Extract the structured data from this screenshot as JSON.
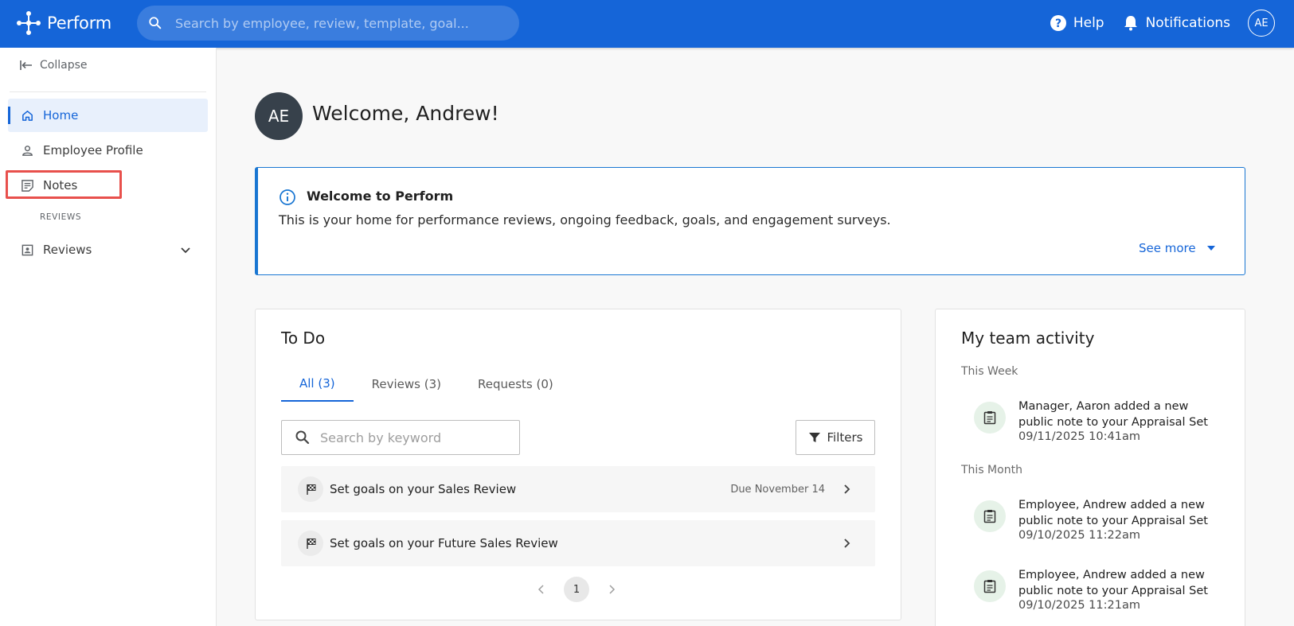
{
  "app": {
    "name": "Perform"
  },
  "header": {
    "search_placeholder": "Search by employee, review, template, goal...",
    "help_label": "Help",
    "notifications_label": "Notifications",
    "user_initials": "AE"
  },
  "sidebar": {
    "collapse_label": "Collapse",
    "items": [
      {
        "label": "Home",
        "icon": "home-icon",
        "active": true
      },
      {
        "label": "Employee Profile",
        "icon": "person-icon"
      },
      {
        "label": "Notes",
        "icon": "notes-icon",
        "highlighted": true
      }
    ],
    "section_label": "REVIEWS",
    "reviews_label": "Reviews"
  },
  "welcome": {
    "initials": "AE",
    "title": "Welcome, Andrew!"
  },
  "banner": {
    "title": "Welcome to Perform",
    "text": "This is your home for performance reviews, ongoing feedback, goals, and engagement surveys.",
    "see_more": "See more"
  },
  "todo": {
    "title": "To Do",
    "tabs": [
      {
        "label": "All (3)",
        "active": true
      },
      {
        "label": "Reviews (3)"
      },
      {
        "label": "Requests (0)"
      }
    ],
    "search_placeholder": "Search by keyword",
    "filters_label": "Filters",
    "rows": [
      {
        "text": "Set goals on your Sales Review",
        "due": "Due November 14"
      },
      {
        "text": "Set goals on your Future Sales Review",
        "due": ""
      }
    ],
    "page": "1"
  },
  "team": {
    "title": "My team activity",
    "groups": [
      {
        "label": "This Week"
      },
      {
        "label": "This Month"
      }
    ],
    "activities": [
      {
        "text": "Manager, Aaron added a new public note to your Appraisal Set",
        "time": "09/11/2025 10:41am"
      },
      {
        "text": "Employee, Andrew added a new public note to your Appraisal Set",
        "time": "09/10/2025 11:22am"
      },
      {
        "text": "Employee, Andrew added a new public note to your Appraisal Set",
        "time": "09/10/2025 11:21am"
      }
    ]
  },
  "colors": {
    "brand": "#1565d8",
    "highlight": "#e8504c",
    "avatar": "#37414b"
  }
}
